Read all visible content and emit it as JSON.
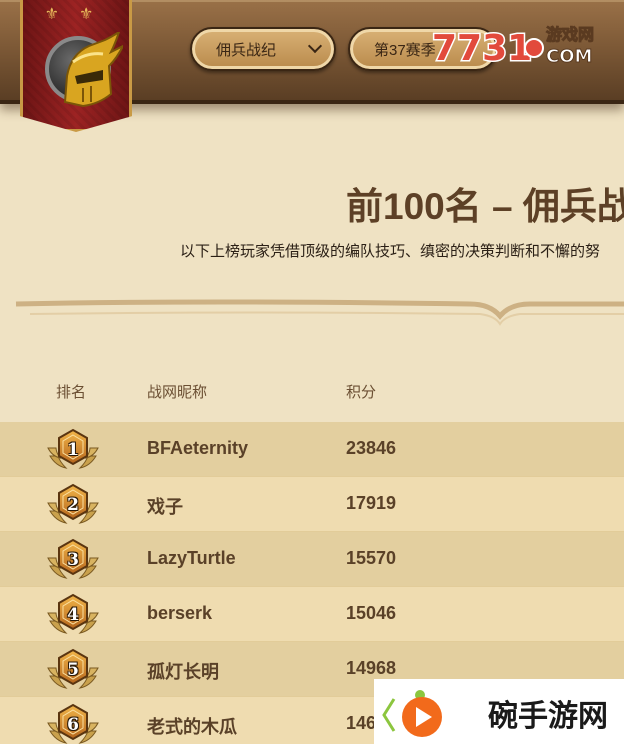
{
  "header": {
    "mode_selector": {
      "value": "佣兵战纪"
    },
    "season_selector": {
      "value": "第37赛季"
    }
  },
  "watermark_top": {
    "text": "7731",
    "site": "游戏网",
    "domain": "COM"
  },
  "title": "前100名 – 佣兵战",
  "subtitle": "以下上榜玩家凭借顶级的编队技巧、缜密的决策判断和不懈的努",
  "table": {
    "headers": {
      "rank": "排名",
      "name": "战网昵称",
      "score": "积分"
    },
    "rows": [
      {
        "rank": "1",
        "name": "BFAeternity",
        "score": "23846"
      },
      {
        "rank": "2",
        "name": "戏子",
        "score": "17919"
      },
      {
        "rank": "3",
        "name": "LazyTurtle",
        "score": "15570"
      },
      {
        "rank": "4",
        "name": "berserk",
        "score": "15046"
      },
      {
        "rank": "5",
        "name": "孤灯长明",
        "score": "14968"
      },
      {
        "rank": "6",
        "name": "老式的木瓜",
        "score": "146"
      }
    ]
  },
  "watermark_bottom": {
    "text": "碗手游网"
  },
  "colors": {
    "background": "#efe2c3",
    "header_wood": "#7e5a37",
    "banner_red": "#9d2323",
    "row_dark": "#e3cf9f",
    "row_light": "#efdcb0",
    "text_brown": "#5a4128"
  },
  "icons": {
    "emblem": "golden-helmet-icon",
    "dropdown": "chevron-down-icon",
    "rank_badge": "hexagon-laurel-badge-icon"
  }
}
